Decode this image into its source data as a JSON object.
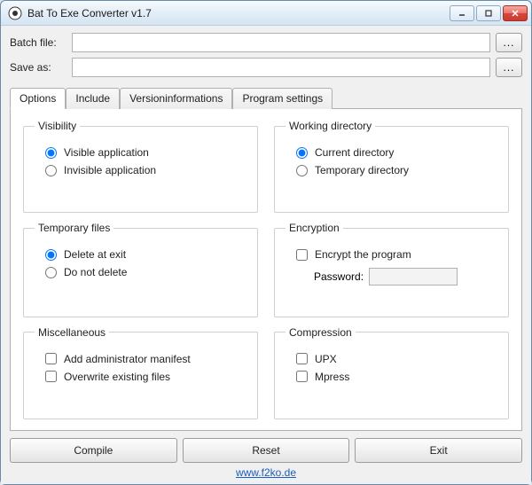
{
  "window": {
    "title": "Bat To Exe Converter v1.7"
  },
  "files": {
    "batch_label": "Batch file:",
    "batch_value": "",
    "saveas_label": "Save as:",
    "saveas_value": "",
    "browse_label": "..."
  },
  "tabs": {
    "options": "Options",
    "include": "Include",
    "versioninfo": "Versioninformations",
    "programsettings": "Program settings"
  },
  "groups": {
    "visibility": {
      "title": "Visibility",
      "visible": "Visible application",
      "invisible": "Invisible application"
    },
    "workingdir": {
      "title": "Working directory",
      "current": "Current directory",
      "temp": "Temporary directory"
    },
    "tempfiles": {
      "title": "Temporary files",
      "delete": "Delete at exit",
      "keep": "Do not delete"
    },
    "encryption": {
      "title": "Encryption",
      "encrypt": "Encrypt the program",
      "password_label": "Password:",
      "password_value": ""
    },
    "misc": {
      "title": "Miscellaneous",
      "manifest": "Add administrator manifest",
      "overwrite": "Overwrite existing files"
    },
    "compression": {
      "title": "Compression",
      "upx": "UPX",
      "mpress": "Mpress"
    }
  },
  "buttons": {
    "compile": "Compile",
    "reset": "Reset",
    "exit": "Exit"
  },
  "footer": {
    "link": "www.f2ko.de"
  }
}
